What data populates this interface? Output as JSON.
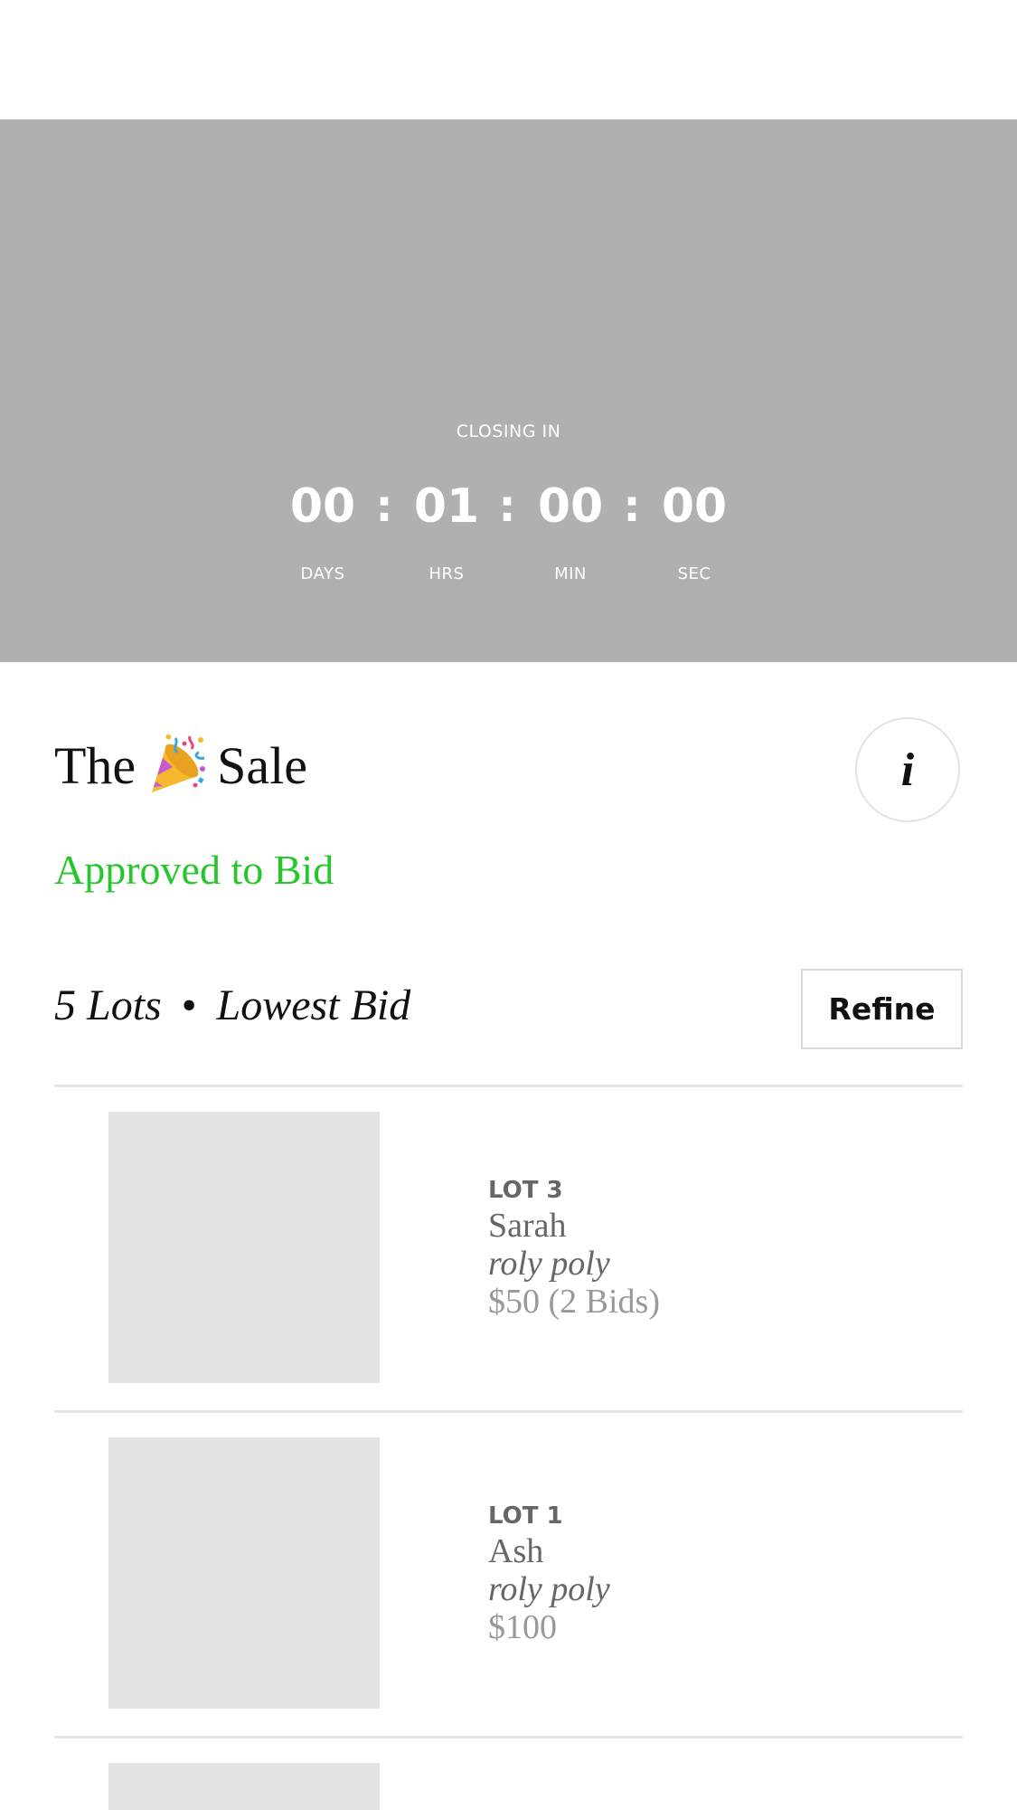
{
  "countdown": {
    "heading": "CLOSING IN",
    "units": [
      {
        "value": "00",
        "label": "DAYS"
      },
      {
        "value": "01",
        "label": "HRS"
      },
      {
        "value": "00",
        "label": "MIN"
      },
      {
        "value": "00",
        "label": "SEC"
      }
    ],
    "separator": ":"
  },
  "sale": {
    "title_before": "The",
    "title_icon": "party-popper-icon",
    "title_after": "Sale",
    "info_label": "i",
    "status": "Approved to Bid",
    "status_color": "#27c62d"
  },
  "lots_header": {
    "count": "5 Lots",
    "separator": "•",
    "sort": "Lowest Bid",
    "refine_label": "Refine"
  },
  "lots": [
    {
      "number": "LOT 3",
      "artist": "Sarah",
      "title": "roly poly",
      "price": "$50 (2 Bids)"
    },
    {
      "number": "LOT 1",
      "artist": "Ash",
      "title": "roly poly",
      "price": "$100"
    }
  ],
  "colors": {
    "hero_background": "#b0b0b0",
    "thumbnail_placeholder": "#e3e3e3"
  }
}
